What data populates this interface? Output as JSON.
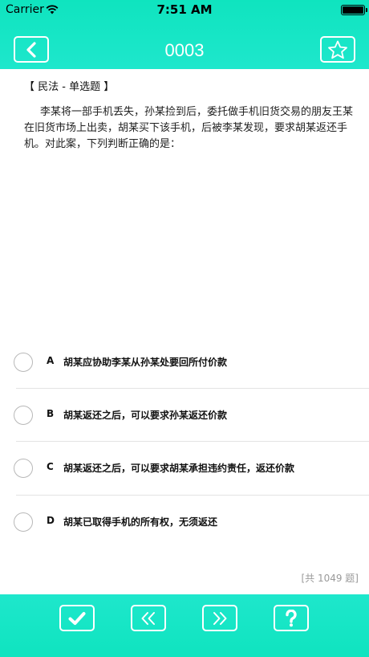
{
  "status_bar": {
    "carrier": "Carrier",
    "time": "7:51 AM"
  },
  "header": {
    "title": "0003",
    "back_icon": "chevron-left-icon",
    "favorite_icon": "star-icon"
  },
  "question": {
    "type_label": "【 民法 - 单选题 】",
    "text": "李某将一部手机丢失，孙某捡到后，委托做手机旧货交易的朋友王某在旧货市场上出卖，胡某买下该手机，后被李某发现，要求胡某返还手机。对此案，下列判断正确的是："
  },
  "options": [
    {
      "letter": "A",
      "text": "胡某应协助李某从孙某处要回所付价款"
    },
    {
      "letter": "B",
      "text": "胡某返还之后，可以要求孙某返还价款"
    },
    {
      "letter": "C",
      "text": "胡某返还之后，可以要求胡某承担违约责任，返还价款"
    },
    {
      "letter": "D",
      "text": "胡某已取得手机的所有权，无须返还"
    }
  ],
  "footer": {
    "counter": "[共 1049 题]",
    "buttons": [
      "check-icon",
      "double-chevron-left-icon",
      "double-chevron-right-icon",
      "question-mark-icon"
    ]
  },
  "colors": {
    "accent": "#1ee7cc",
    "text": "#111111",
    "muted": "#9a9a9a"
  }
}
